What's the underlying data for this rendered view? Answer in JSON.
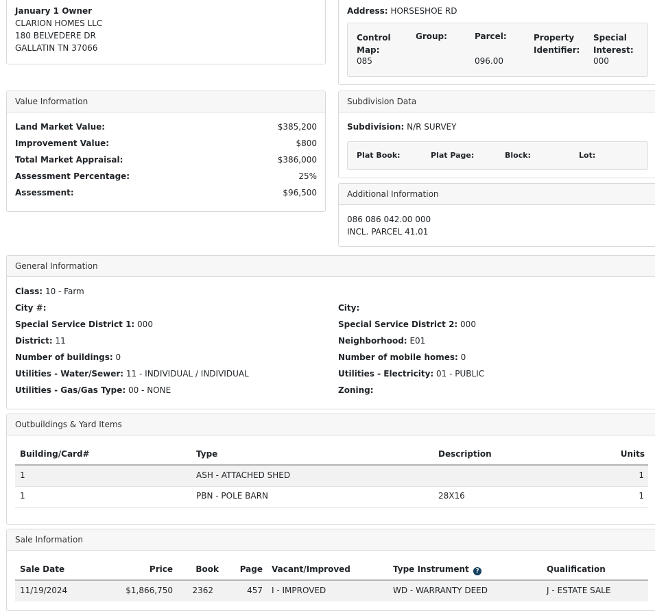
{
  "owner": {
    "heading": "January 1 Owner",
    "name": "CLARION HOMES LLC",
    "street": "180 BELVEDERE DR",
    "city_state_zip": "GALLATIN TN 37066"
  },
  "location": {
    "address_label": "Address:",
    "address_value": "HORSESHOE RD",
    "control_map_label": "Control Map:",
    "control_map_value": "085",
    "group_label": "Group:",
    "group_value": "",
    "parcel_label": "Parcel:",
    "parcel_value": "096.00",
    "property_identifier_label": "Property Identifier:",
    "property_identifier_value": "",
    "special_interest_label": "Special Interest:",
    "special_interest_value": "000"
  },
  "value_info": {
    "title": "Value Information",
    "rows": [
      {
        "label": "Land Market Value:",
        "value": "$385,200"
      },
      {
        "label": "Improvement Value:",
        "value": "$800"
      },
      {
        "label": "Total Market Appraisal:",
        "value": "$386,000"
      },
      {
        "label": "Assessment Percentage:",
        "value": "25%"
      },
      {
        "label": "Assessment:",
        "value": "$96,500"
      }
    ]
  },
  "subdivision": {
    "title": "Subdivision Data",
    "subdivision_label": "Subdivision:",
    "subdivision_value": "N/R SURVEY",
    "plat_book_label": "Plat Book:",
    "plat_page_label": "Plat Page:",
    "block_label": "Block:",
    "lot_label": "Lot:"
  },
  "additional": {
    "title": "Additional Information",
    "line1": "086 086 042.00 000",
    "line2": "INCL. PARCEL 41.01"
  },
  "general": {
    "title": "General Information",
    "class_label": "Class:",
    "class_value": "10 - Farm",
    "left": [
      {
        "label": "City #:",
        "value": ""
      },
      {
        "label": "Special Service District 1:",
        "value": "000"
      },
      {
        "label": "District:",
        "value": "11"
      },
      {
        "label": "Number of buildings:",
        "value": "0"
      },
      {
        "label": "Utilities - Water/Sewer:",
        "value": "11 - INDIVIDUAL / INDIVIDUAL"
      },
      {
        "label": "Utilities - Gas/Gas Type:",
        "value": "00 - NONE"
      }
    ],
    "right": [
      {
        "label": "City:",
        "value": ""
      },
      {
        "label": "Special Service District 2:",
        "value": "000"
      },
      {
        "label": "Neighborhood:",
        "value": "E01"
      },
      {
        "label": "Number of mobile homes:",
        "value": "0"
      },
      {
        "label": "Utilities - Electricity:",
        "value": "01 - PUBLIC"
      },
      {
        "label": "Zoning:",
        "value": ""
      }
    ]
  },
  "outbuildings": {
    "title": "Outbuildings & Yard Items",
    "headers": [
      "Building/Card#",
      "Type",
      "Description",
      "Units"
    ],
    "rows": [
      [
        "1",
        "ASH - ATTACHED SHED",
        "",
        "1"
      ],
      [
        "1",
        "PBN - POLE BARN",
        "28X16",
        "1"
      ]
    ]
  },
  "sales": {
    "title": "Sale Information",
    "headers": [
      "Sale Date",
      "Price",
      "Book",
      "Page",
      "Vacant/Improved",
      "Type Instrument",
      "Qualification"
    ],
    "help_glyph": "?",
    "rows": [
      [
        "11/19/2024",
        "$1,866,750",
        "2362",
        "457",
        "I - IMPROVED",
        "WD - WARRANTY DEED",
        "J - ESTATE SALE"
      ]
    ]
  }
}
